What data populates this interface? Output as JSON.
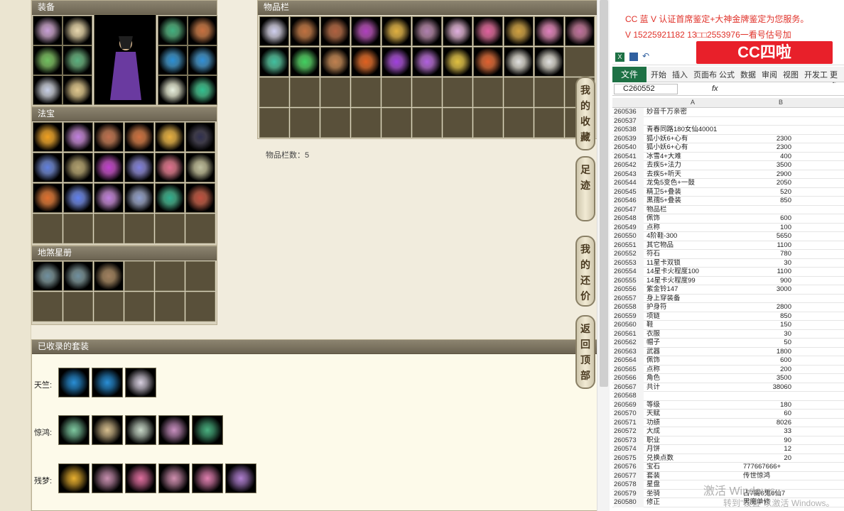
{
  "equip_title": "装备",
  "fabao_title": "法宝",
  "shenshou_title": "地煞星册",
  "items_title": "物品栏",
  "item_count": "物品栏数：5",
  "suits_title": "已收录的套装",
  "suits": [
    {
      "name": "天竺:",
      "colors": [
        "#2a8fd6",
        "#2a8fd6",
        "#d8d0e0"
      ]
    },
    {
      "name": "惊鸿:",
      "colors": [
        "#7ec8a0",
        "#d8c090",
        "#c8d8c8",
        "#c890c0",
        "#4ab080"
      ]
    },
    {
      "name": "残梦:",
      "colors": [
        "#e8b030",
        "#c890b0",
        "#e070a0",
        "#d090b0",
        "#e080b0",
        "#b080d0"
      ]
    }
  ],
  "equip_colors": [
    "#c8a0d8",
    "#e8d8b0",
    "#40b080",
    "#c87040",
    "#70c060",
    "#5ab080",
    "#2a8fd6",
    "#3090d8",
    "#c8d0e8",
    "#e0c890",
    "#e8f0e0",
    "#30c090"
  ],
  "fabao_colors": [
    "#f0a020",
    "#c080e0",
    "#c07050",
    "#d07040",
    "#e8b040",
    "#303050",
    "#6080e0",
    "#b0a070",
    "#c040d0",
    "#8080e0",
    "#e07090",
    "#c0c0a0",
    "#e07030",
    "#6080f0",
    "#c080e0",
    "#90a0d0",
    "#30b090",
    "#c05040"
  ],
  "shenshou_colors": [
    "#7090a0",
    "#7090a0",
    "#a08060"
  ],
  "items_colors": [
    [
      "#d0d0f0",
      "#c07040",
      "#b06040",
      "#b040c0",
      "#e0b040",
      "#b080b0",
      "#e0b0e0",
      "#e060a0",
      "#d0a040",
      "#e080c0",
      "#c070a0"
    ],
    [
      "#40c0a0",
      "#40d060",
      "#c08050",
      "#e06020",
      "#a040e0",
      "#b060e0",
      "#e0c040",
      "#e06030",
      "#e0e0e0",
      "#e0e0e0"
    ]
  ],
  "side_buttons": [
    "我的收藏",
    "足迹",
    "我的还价",
    "返回顶部"
  ],
  "ad_lines": [
    "CC 蓝 V 认证首席鉴定+大神金牌鉴定为您服务。",
    "V 15225921182      13□□2553976一看号估号加"
  ],
  "cc_label": "CC四啦",
  "excel": {
    "tabs": [
      "文件",
      "开始",
      "插入",
      "页面布",
      "公式",
      "数据",
      "审阅",
      "视图",
      "开发工",
      "更多"
    ],
    "namebox": "C260552",
    "fx": "fx",
    "col_a": "A",
    "col_b": "B",
    "rows": [
      [
        "260536",
        "妙音千万亲密",
        ""
      ],
      [
        "260537",
        "",
        ""
      ],
      [
        "260538",
        "青春同路180女仙40001",
        ""
      ],
      [
        "260539",
        "狐小妖6+心有",
        "2300"
      ],
      [
        "260540",
        "狐小妖6+心有",
        "2300"
      ],
      [
        "260541",
        "冰雪4+大难",
        "400"
      ],
      [
        "260542",
        "去疾5+法力",
        "3500"
      ],
      [
        "260543",
        "去疾5+听天",
        "2900"
      ],
      [
        "260544",
        "龙兔5变色+一鼓",
        "2050"
      ],
      [
        "260545",
        "精卫5+叠装",
        "520"
      ],
      [
        "260546",
        "黑孺5+叠装",
        "850"
      ],
      [
        "260547",
        "物品栏",
        ""
      ],
      [
        "260548",
        "佩饰",
        "600"
      ],
      [
        "260549",
        "点称",
        "100"
      ],
      [
        "260550",
        "4阶鞋-300",
        "5650"
      ],
      [
        "260551",
        "其它物品",
        "1100"
      ],
      [
        "260552",
        "符石",
        "780"
      ],
      [
        "260553",
        "11星卡双锁",
        "30"
      ],
      [
        "260554",
        "14星卡火程度100",
        "1100"
      ],
      [
        "260555",
        "14星卡火程度99",
        "900"
      ],
      [
        "260556",
        "紫金铃147",
        "3000"
      ],
      [
        "260557",
        "身上穿装备",
        ""
      ],
      [
        "260558",
        "护身符",
        "2800"
      ],
      [
        "260559",
        "项链",
        "850"
      ],
      [
        "260560",
        "鞋",
        "150"
      ],
      [
        "260561",
        "衣服",
        "30"
      ],
      [
        "260562",
        "帽子",
        "50"
      ],
      [
        "260563",
        "武器",
        "1800"
      ],
      [
        "260564",
        "佩饰",
        "600"
      ],
      [
        "260565",
        "点称",
        "200"
      ],
      [
        "260566",
        "角色",
        "3500"
      ],
      [
        "260567",
        "共计",
        "38060"
      ],
      [
        "260568",
        "",
        ""
      ],
      [
        "260569",
        "等级",
        "180"
      ],
      [
        "260570",
        "天赋",
        "60"
      ],
      [
        "260571",
        "功绩",
        "8026"
      ],
      [
        "260572",
        "大成",
        "33"
      ],
      [
        "260573",
        "职业",
        "90"
      ],
      [
        "260574",
        "月饼",
        "12"
      ],
      [
        "260575",
        "兑换点数",
        "20"
      ],
      [
        "260576",
        "宝石",
        "777667666+"
      ],
      [
        "260577",
        "套装",
        "传世惊鸿"
      ],
      [
        "260578",
        "星盘",
        ""
      ],
      [
        "260579",
        "坐骑",
        "占7离6鬼6仙7"
      ],
      [
        "260580",
        "修正",
        "男魔单修"
      ]
    ]
  },
  "watermark1": "激活 Windows",
  "watermark2": "转到\"设置\"以激活 Windows。"
}
